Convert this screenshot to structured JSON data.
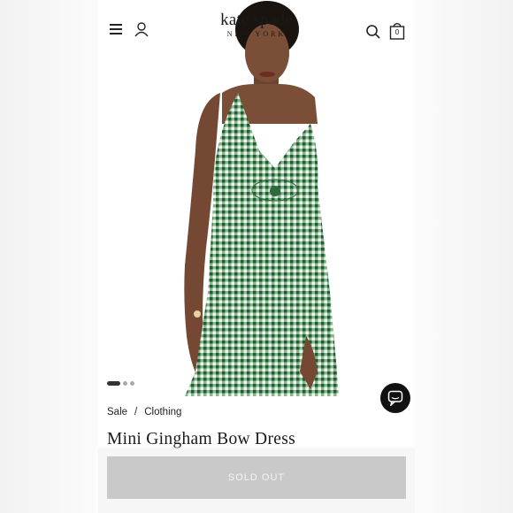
{
  "header": {
    "brand_name": "kate spade",
    "brand_sub": "NEW YORK",
    "bag_count": "0",
    "icons": [
      "menu-icon",
      "account-icon",
      "search-icon",
      "bag-icon"
    ]
  },
  "carousel": {
    "image_count": 3,
    "active_index": 0
  },
  "breadcrumb": {
    "items": [
      "Sale",
      "Clothing"
    ],
    "separator": "/"
  },
  "product": {
    "title": "Mini Gingham Bow Dress",
    "button_label": "SOLD OUT"
  },
  "colors": {
    "gingham": "#3f8a52",
    "button": "#c9c9c9",
    "chat": "#111111"
  }
}
